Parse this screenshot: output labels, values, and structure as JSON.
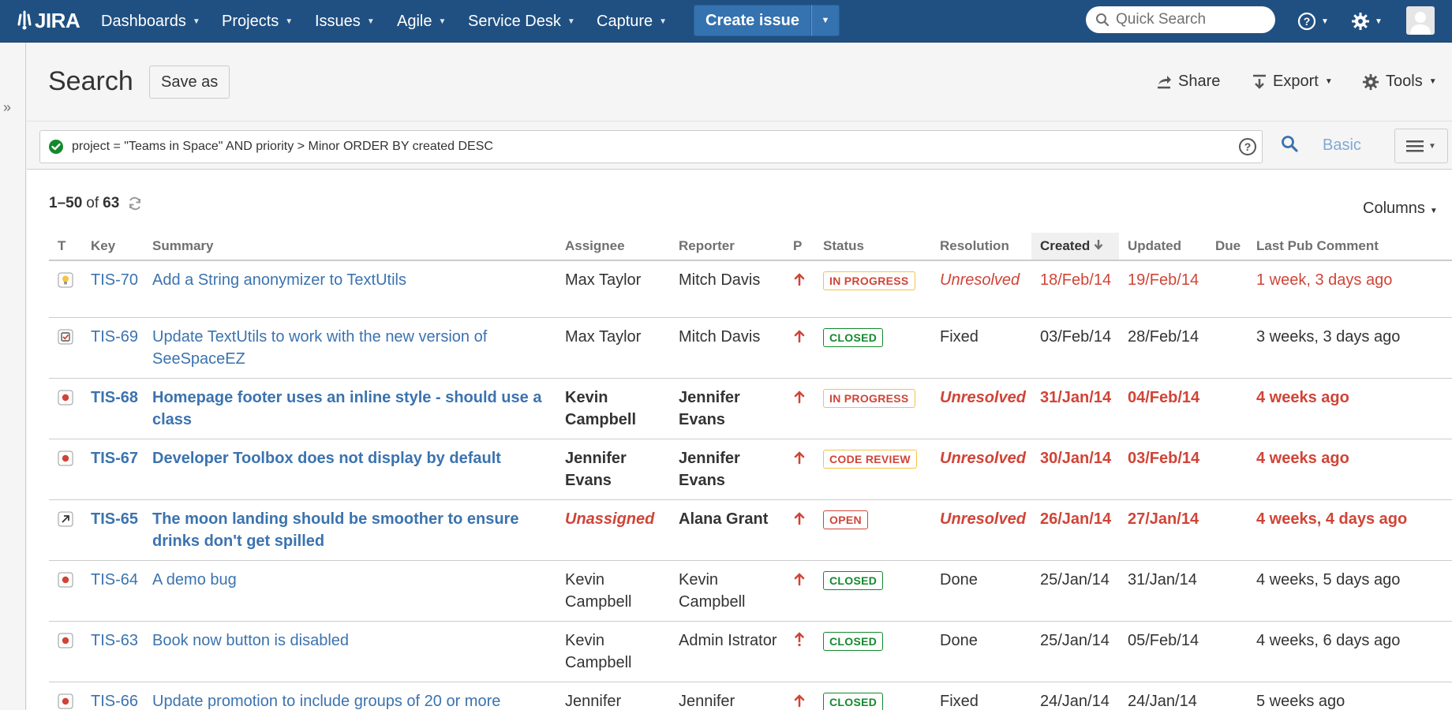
{
  "nav": {
    "logo": "JIRA",
    "items": [
      {
        "label": "Dashboards"
      },
      {
        "label": "Projects"
      },
      {
        "label": "Issues"
      },
      {
        "label": "Agile"
      },
      {
        "label": "Service Desk"
      },
      {
        "label": "Capture"
      }
    ],
    "create_label": "Create issue",
    "search_placeholder": "Quick Search",
    "help_icon": "help-icon",
    "settings_icon": "gear-icon",
    "brand_color": "#205081"
  },
  "header": {
    "title": "Search",
    "save_as": "Save as",
    "share": "Share",
    "export": "Export",
    "tools": "Tools"
  },
  "jql": {
    "query": "project = \"Teams in Space\" AND priority > Minor ORDER BY created DESC",
    "status": "valid",
    "basic_label": "Basic"
  },
  "results": {
    "range": "1–50",
    "of": "of",
    "total": "63",
    "columns_label": "Columns",
    "headers": {
      "t": "T",
      "key": "Key",
      "summary": "Summary",
      "assignee": "Assignee",
      "reporter": "Reporter",
      "p": "P",
      "status": "Status",
      "resolution": "Resolution",
      "created": "Created",
      "updated": "Updated",
      "due": "Due",
      "last_comment": "Last Pub Comment"
    },
    "rows": [
      {
        "type": "improvement",
        "key": "TIS-70",
        "summary": "Add a String anonymizer to TextUtils",
        "assignee": "Max Taylor",
        "reporter": "Mitch Davis",
        "priority": "major",
        "status": "IN PROGRESS",
        "resolution": "Unresolved",
        "created": "18/Feb/14",
        "updated": "19/Feb/14",
        "due": "",
        "last_comment": "1 week, 3 days ago"
      },
      {
        "type": "task",
        "key": "TIS-69",
        "summary": "Update TextUtils to work with the new version of SeeSpaceEZ",
        "assignee": "Max Taylor",
        "reporter": "Mitch Davis",
        "priority": "major",
        "status": "CLOSED",
        "resolution": "Fixed",
        "created": "03/Feb/14",
        "updated": "28/Feb/14",
        "due": "",
        "last_comment": "3 weeks, 3 days ago"
      },
      {
        "type": "bug",
        "key": "TIS-68",
        "summary": "Homepage footer uses an inline style - should use a class",
        "assignee": "Kevin Campbell",
        "reporter": "Jennifer Evans",
        "priority": "major",
        "status": "IN PROGRESS",
        "resolution": "Unresolved",
        "created": "31/Jan/14",
        "updated": "04/Feb/14",
        "due": "",
        "last_comment": "4 weeks ago"
      },
      {
        "type": "bug",
        "key": "TIS-67",
        "summary": "Developer Toolbox does not display by default",
        "assignee": "Jennifer Evans",
        "reporter": "Jennifer Evans",
        "priority": "major",
        "status": "CODE REVIEW",
        "resolution": "Unresolved",
        "created": "30/Jan/14",
        "updated": "03/Feb/14",
        "due": "",
        "last_comment": "4 weeks ago"
      },
      {
        "type": "subtask",
        "key": "TIS-65",
        "summary": "The moon landing should be smoother to ensure drinks don't get spilled",
        "assignee": "Unassigned",
        "reporter": "Alana Grant",
        "priority": "major",
        "status": "OPEN",
        "resolution": "Unresolved",
        "created": "26/Jan/14",
        "updated": "27/Jan/14",
        "due": "",
        "last_comment": "4 weeks, 4 days ago"
      },
      {
        "type": "bug",
        "key": "TIS-64",
        "summary": "A demo bug",
        "assignee": "Kevin Campbell",
        "reporter": "Kevin Campbell",
        "priority": "major",
        "status": "CLOSED",
        "resolution": "Done",
        "created": "25/Jan/14",
        "updated": "31/Jan/14",
        "due": "",
        "last_comment": "4 weeks, 5 days ago"
      },
      {
        "type": "bug",
        "key": "TIS-63",
        "summary": "Book now button is disabled",
        "assignee": "Kevin Campbell",
        "reporter": "Admin Istrator",
        "priority": "blocker",
        "status": "CLOSED",
        "resolution": "Done",
        "created": "25/Jan/14",
        "updated": "05/Feb/14",
        "due": "",
        "last_comment": "4 weeks, 6 days ago"
      },
      {
        "type": "bug",
        "key": "TIS-66",
        "summary": "Update promotion to include groups of 20 or more",
        "assignee": "Jennifer Evans",
        "reporter": "Jennifer Evans",
        "priority": "major",
        "status": "CLOSED",
        "resolution": "Fixed",
        "created": "24/Jan/14",
        "updated": "24/Jan/14",
        "due": "",
        "last_comment": "5 weeks ago"
      }
    ]
  }
}
